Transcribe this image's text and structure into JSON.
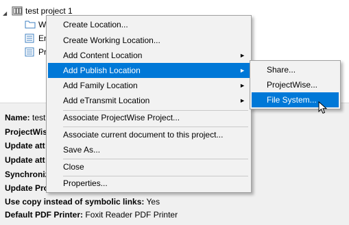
{
  "tree": {
    "root_label": "test project 1",
    "children": [
      "W",
      "En",
      "Pr"
    ]
  },
  "properties": [
    {
      "label": "Name:",
      "value": "test"
    },
    {
      "label": "ProjectWis",
      "value": ""
    },
    {
      "label": "Update att",
      "value": ""
    },
    {
      "label": "Update att",
      "value": ""
    },
    {
      "label": "Synchroniz",
      "value": ""
    },
    {
      "label": "Update Pro",
      "value": ""
    },
    {
      "label": "Use copy instead of symbolic links:",
      "value": "Yes"
    },
    {
      "label": "Default PDF Printer:",
      "value": "Foxit Reader PDF Printer"
    }
  ],
  "context_menu": {
    "items": [
      {
        "label": "Create Location..."
      },
      {
        "label": "Create Working Location..."
      },
      {
        "label": "Add Content Location"
      },
      {
        "label": "Add Publish Location"
      },
      {
        "label": "Add Family Location"
      },
      {
        "label": "Add eTransmit Location"
      },
      {
        "label": "Associate ProjectWise Project..."
      },
      {
        "label": "Associate current document to this project..."
      },
      {
        "label": "Save As..."
      },
      {
        "label": "Close"
      },
      {
        "label": "Properties..."
      }
    ],
    "highlighted": "Add Publish Location",
    "submenu_arrow": "►"
  },
  "submenu": {
    "items": [
      {
        "label": "Share..."
      },
      {
        "label": "ProjectWise..."
      },
      {
        "label": "File System..."
      }
    ],
    "highlighted": "File System..."
  },
  "colors": {
    "highlight": "#0078d7",
    "menu_bg": "#f2f2f2",
    "panel_bg": "#f0f0f0"
  }
}
